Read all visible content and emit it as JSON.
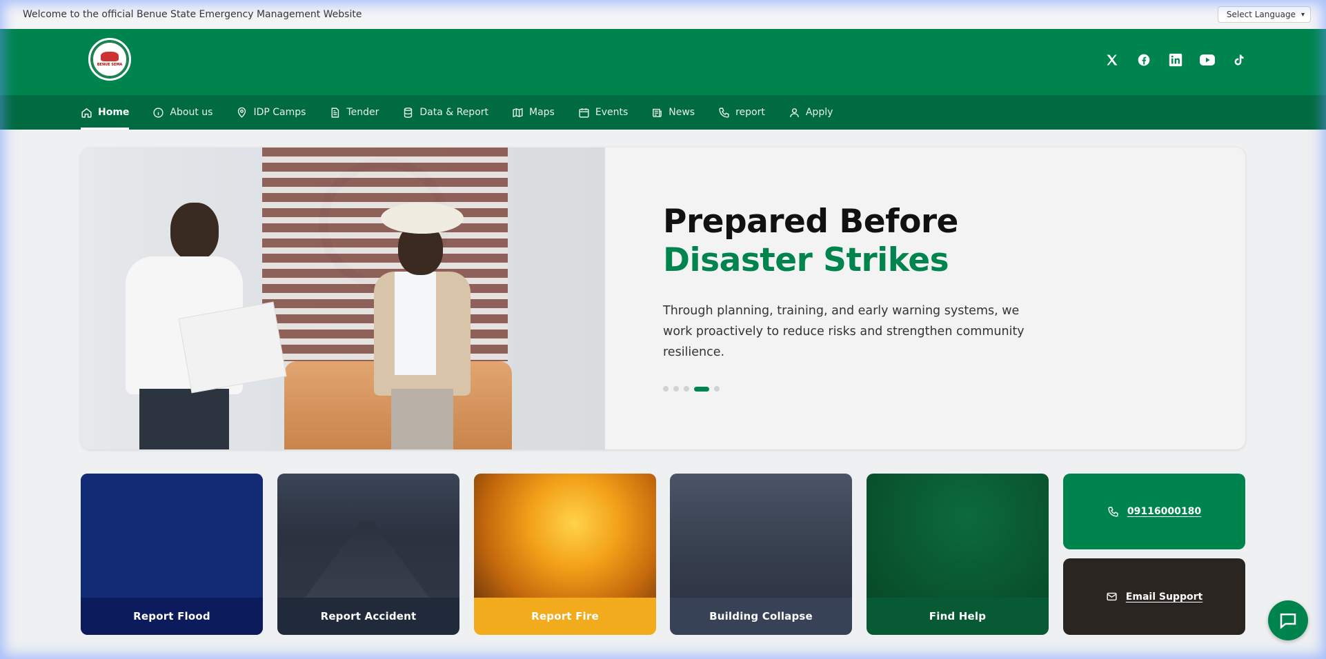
{
  "topbar": {
    "welcome": "Welcome to the official Benue State Emergency Management Website",
    "language_label": "Select Language"
  },
  "header": {
    "logo_text": "BENUE SEMA",
    "socials": [
      "x-icon",
      "facebook-icon",
      "linkedin-icon",
      "youtube-icon",
      "tiktok-icon"
    ]
  },
  "nav": {
    "items": [
      {
        "label": "Home",
        "icon": "home-icon",
        "active": true
      },
      {
        "label": "About us",
        "icon": "info-icon"
      },
      {
        "label": "IDP Camps",
        "icon": "location-pin-icon"
      },
      {
        "label": "Tender",
        "icon": "document-icon"
      },
      {
        "label": "Data & Report",
        "icon": "database-icon"
      },
      {
        "label": "Maps",
        "icon": "map-icon"
      },
      {
        "label": "Events",
        "icon": "calendar-icon"
      },
      {
        "label": "News",
        "icon": "newspaper-icon"
      },
      {
        "label": "report",
        "icon": "phone-icon"
      },
      {
        "label": "Apply",
        "icon": "user-icon"
      }
    ]
  },
  "hero": {
    "title_part1": "Prepared Before ",
    "title_accent": "Disaster Strikes",
    "description": "Through planning, training, and early warning systems, we work proactively to reduce risks and strengthen community resilience.",
    "slides_total": 5,
    "active_slide": 4
  },
  "cards": {
    "flood": "Report Flood",
    "accident": "Report Accident",
    "fire": "Report Fire",
    "collapse": "Building Collapse",
    "help": "Find Help",
    "phone": "09116000180",
    "email": "Email Support"
  },
  "colors": {
    "brand_green": "#00844e",
    "nav_green": "#006b40",
    "flood_blue": "#132a75",
    "fire_orange": "#f2ab1d"
  }
}
